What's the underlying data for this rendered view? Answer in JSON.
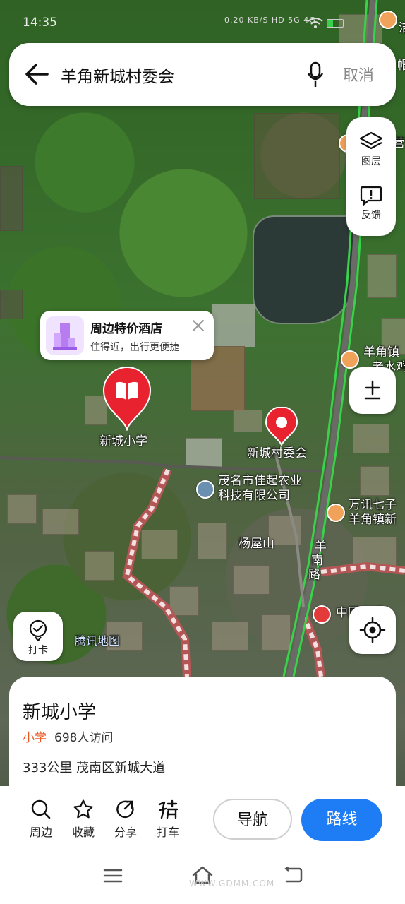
{
  "status": {
    "time": "14:35",
    "icons_text": "0.20 KB/S HD 5G 4G"
  },
  "search": {
    "query": "羊角新城村委会",
    "cancel_label": "取消"
  },
  "tools": {
    "layers_label": "图层",
    "feedback_label": "反馈"
  },
  "hotel_popup": {
    "title": "周边特价酒店",
    "subtitle": "住得近，出行更便捷"
  },
  "map_labels": {
    "school": "新城小学",
    "village_committee": "新城村委会",
    "company_line1": "茂名市佳起农业",
    "company_line2": "科技有限公司",
    "hill": "杨屋山",
    "road_char1": "羊",
    "road_char2": "南",
    "road_char3": "路",
    "yangjiao_line1": "羊角镇",
    "yangjiao_line2": "老水鸡",
    "wanxun_line1": "万讯七子",
    "wanxun_line2": "羊角镇新",
    "unicom": "中国联通",
    "tencent_map": "腾讯地图",
    "edge_char1": "洁",
    "edge_char2": "帽",
    "edge_char3": "营"
  },
  "checkin_label": "打卡",
  "place_sheet": {
    "title": "新城小学",
    "category": "小学",
    "visits": "698人访问",
    "address": "333公里   茂南区新城大道"
  },
  "actions": {
    "nearby": "周边",
    "favorite": "收藏",
    "share": "分享",
    "taxi": "打车",
    "navigate": "导航",
    "route": "路线"
  },
  "watermark": "WWW.GDMM.COM",
  "colors": {
    "accent": "#1e7cf5",
    "marker": "#e8232f",
    "category": "#e85a24"
  }
}
